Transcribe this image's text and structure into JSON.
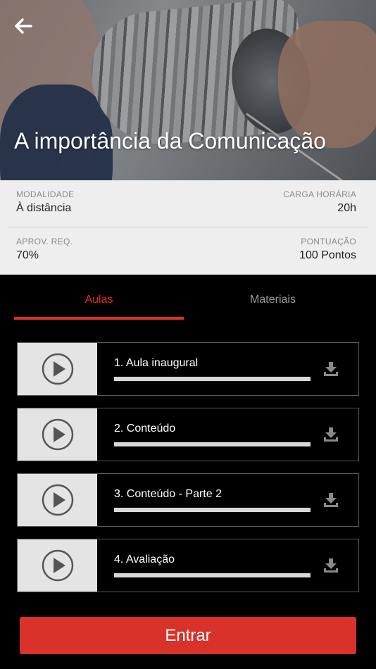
{
  "course": {
    "title": "A importância da Comunicação"
  },
  "info": {
    "modalidade": {
      "label": "MODALIDADE",
      "value": "À distância"
    },
    "carga": {
      "label": "CARGA HORÁRIA",
      "value": "20h"
    },
    "aprov": {
      "label": "APROV. REQ.",
      "value": "70%"
    },
    "pontuacao": {
      "label": "PONTUAÇÃO",
      "value": "100 Pontos"
    }
  },
  "tabs": [
    {
      "label": "Aulas",
      "active": true
    },
    {
      "label": "Materiais",
      "active": false
    }
  ],
  "lessons": [
    {
      "title": "1. Aula inaugural",
      "progress": 0
    },
    {
      "title": "2. Conteúdo",
      "progress": 0
    },
    {
      "title": "3. Conteúdo - Parte 2",
      "progress": 0
    },
    {
      "title": "4. Avaliação",
      "progress": 0
    }
  ],
  "icons": {
    "back": "arrow-left-icon",
    "play": "play-circle-icon",
    "download": "download-icon"
  },
  "colors": {
    "accent": "#d8322a",
    "background": "#000000",
    "info_panel": "#eeeeee",
    "thumb": "#e4e4e4",
    "inactive_tab": "#9a9a9a"
  },
  "actions": {
    "enter_label": "Entrar"
  }
}
